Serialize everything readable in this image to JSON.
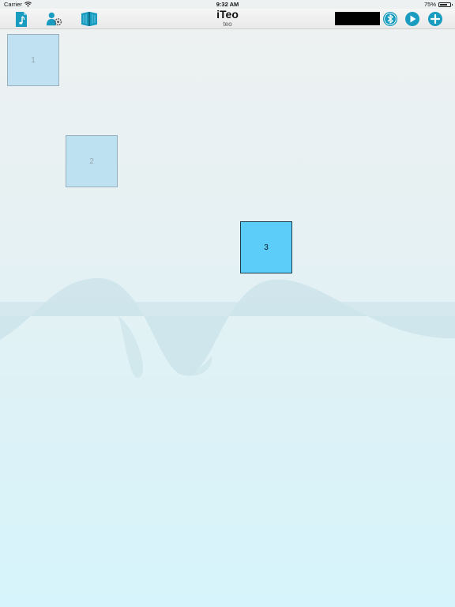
{
  "status_bar": {
    "carrier": "Carrier",
    "time": "9:32 AM",
    "battery": "75%",
    "battery_level": 0.75
  },
  "toolbar": {
    "title": "iTeo",
    "subtitle": "teo",
    "left_icons": [
      "music-document-icon",
      "user-settings-icon",
      "book-icon"
    ],
    "right_icons": [
      "bluetooth-icon",
      "play-icon",
      "add-icon"
    ],
    "accent_color": "#1a9cc0"
  },
  "tiles": [
    {
      "label": "1",
      "state": "faded"
    },
    {
      "label": "2",
      "state": "faded"
    },
    {
      "label": "3",
      "state": "active"
    }
  ],
  "colors": {
    "tile_active": "#5bcdf8",
    "tile_faded": "#bfe3f2",
    "background_bottom": "#d6f4fb"
  }
}
